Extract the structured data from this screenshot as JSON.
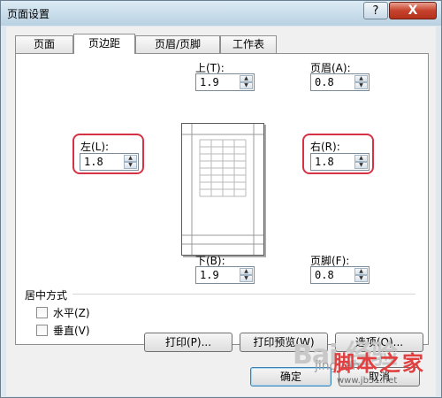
{
  "window": {
    "title": "页面设置",
    "help_label": "?",
    "close_label": "X"
  },
  "tabs": [
    "页面",
    "页边距",
    "页眉/页脚",
    "工作表"
  ],
  "margins": {
    "top": {
      "label": "上(T):",
      "value": "1.9"
    },
    "header": {
      "label": "页眉(A):",
      "value": "0.8"
    },
    "left": {
      "label": "左(L):",
      "value": "1.8"
    },
    "right": {
      "label": "右(R):",
      "value": "1.8"
    },
    "bottom": {
      "label": "下(B):",
      "value": "1.9"
    },
    "footer": {
      "label": "页脚(F):",
      "value": "0.8"
    }
  },
  "center": {
    "title": "居中方式",
    "horizontal": "水平(Z)",
    "vertical": "垂直(V)"
  },
  "buttons": {
    "print": "打印(P)...",
    "print_preview": "打印预览(W)",
    "options": "选项(O)...",
    "ok": "确定",
    "cancel": "取消"
  },
  "watermark": {
    "baidu": "Bai 经验",
    "site_name": "脚本之家",
    "site_sub": "jingyan",
    "site_url": "www.jb51.net"
  },
  "colors": {
    "highlight": "#d63245",
    "close": "#c6422d"
  }
}
